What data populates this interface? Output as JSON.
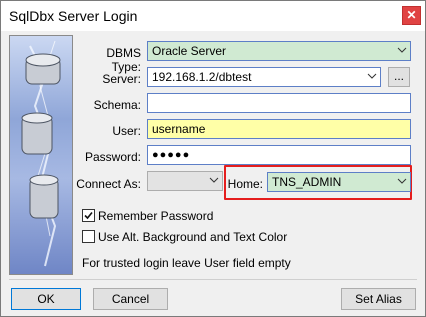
{
  "window": {
    "title": "SqlDbx Server Login",
    "close_icon": "close-icon"
  },
  "form": {
    "dbms_type_label": "DBMS Type:",
    "dbms_type_value": "Oracle Server",
    "server_label": "Server:",
    "server_value": "192.168.1.2/dbtest",
    "browse_label": "...",
    "schema_label": "Schema:",
    "schema_value": "",
    "user_label": "User:",
    "user_value": "username",
    "password_label": "Password:",
    "password_value": "●●●●●",
    "connect_as_label": "Connect As:",
    "connect_as_value": "",
    "home_label": "Home:",
    "home_value": "TNS_ADMIN",
    "remember_label": "Remember Password",
    "remember_checked": true,
    "alt_bg_label": "Use Alt. Background and Text Color",
    "alt_bg_checked": false,
    "hint": "For trusted login leave User field empty"
  },
  "buttons": {
    "ok": "OK",
    "cancel": "Cancel",
    "set_alias": "Set Alias"
  },
  "colors": {
    "green_field": "#d0ead2",
    "yellow_field": "#ffffa7",
    "highlight_red": "#e41d1d"
  }
}
